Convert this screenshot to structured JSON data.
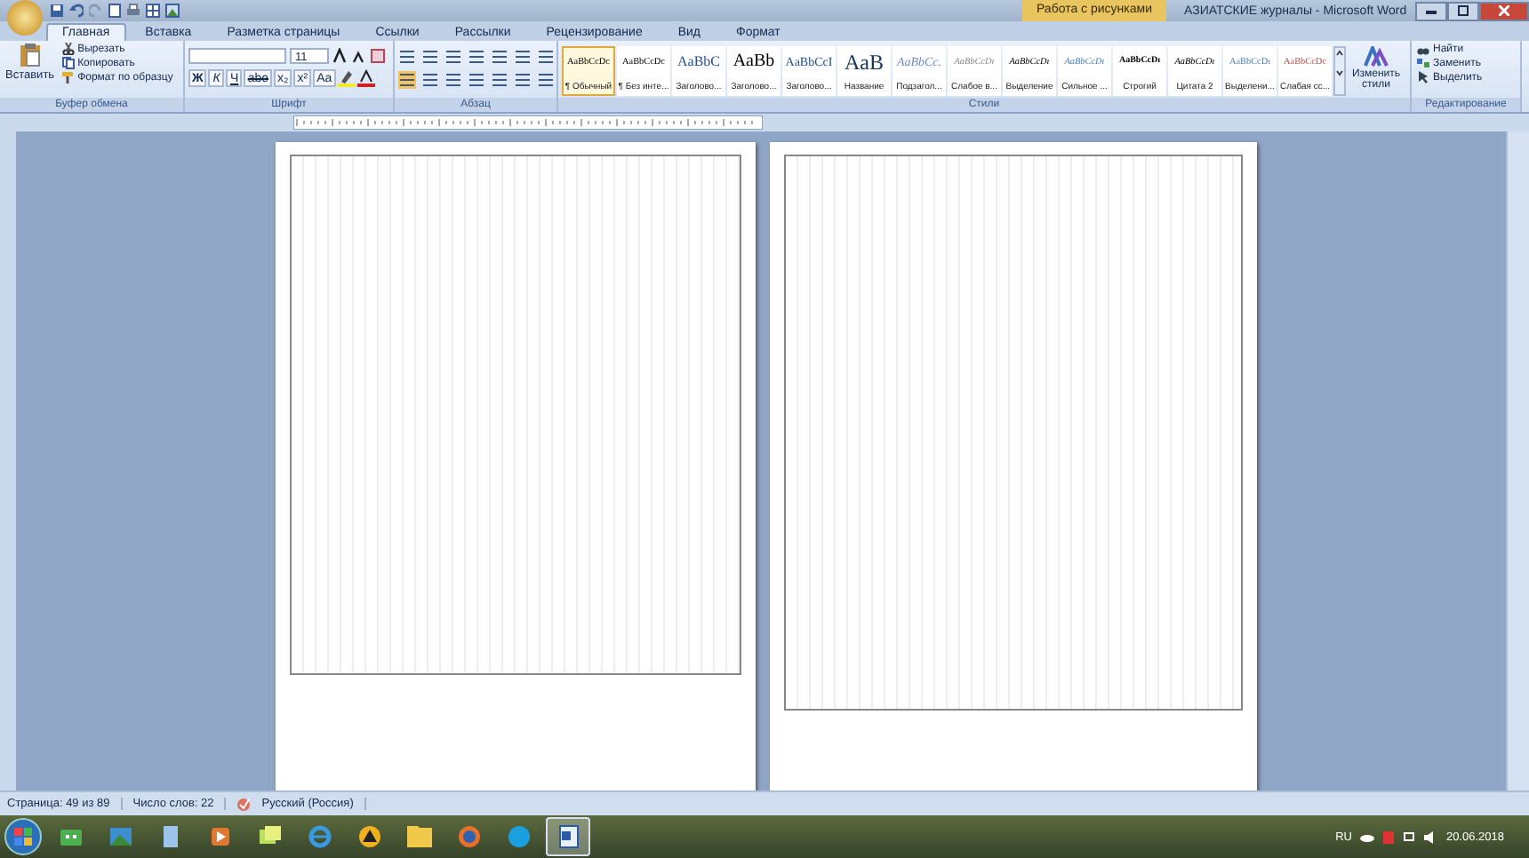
{
  "window": {
    "context_title": "Работа с рисунками",
    "title": "АЗИАТСКИЕ журналы - Microsoft Word"
  },
  "tabs": [
    {
      "label": "Главная",
      "selected": true
    },
    {
      "label": "Вставка",
      "selected": false
    },
    {
      "label": "Разметка страницы",
      "selected": false
    },
    {
      "label": "Ссылки",
      "selected": false
    },
    {
      "label": "Рассылки",
      "selected": false
    },
    {
      "label": "Рецензирование",
      "selected": false
    },
    {
      "label": "Вид",
      "selected": false
    },
    {
      "label": "Формат",
      "selected": false
    }
  ],
  "clipboard": {
    "paste": "Вставить",
    "cut": "Вырезать",
    "copy": "Копировать",
    "format_painter": "Формат по образцу",
    "group": "Буфер обмена"
  },
  "font": {
    "size": "11",
    "format_buttons": [
      "Ж",
      "К",
      "Ч",
      "abe",
      "x₂",
      "x²",
      "Aa"
    ],
    "group": "Шрифт"
  },
  "paragraph": {
    "group": "Абзац"
  },
  "styles": {
    "group": "Стили",
    "change": "Изменить стили",
    "items": [
      {
        "sample": "AaBbCcDc",
        "name": "¶ Обычный",
        "selected": true
      },
      {
        "sample": "AaBbCcDc",
        "name": "¶ Без инте...",
        "selected": false
      },
      {
        "sample": "AaBbC",
        "name": "Заголово...",
        "selected": false
      },
      {
        "sample": "AaBb",
        "name": "Заголово...",
        "selected": false
      },
      {
        "sample": "AaBbCcI",
        "name": "Заголово...",
        "selected": false
      },
      {
        "sample": "AaB",
        "name": "Название",
        "selected": false
      },
      {
        "sample": "AaBbCc.",
        "name": "Подзагол...",
        "selected": false
      },
      {
        "sample": "AaBbCcDı",
        "name": "Слабое в...",
        "selected": false
      },
      {
        "sample": "AaBbCcDı",
        "name": "Выделение",
        "selected": false
      },
      {
        "sample": "AaBbCcDı",
        "name": "Сильное ...",
        "selected": false
      },
      {
        "sample": "AaBbCcDı",
        "name": "Строгий",
        "selected": false
      },
      {
        "sample": "AaBbCcDı",
        "name": "Цитата 2",
        "selected": false
      },
      {
        "sample": "AaBbCcDı",
        "name": "Выделени...",
        "selected": false
      },
      {
        "sample": "AaBbCcDc",
        "name": "Слабая сс...",
        "selected": false
      }
    ]
  },
  "editing": {
    "find": "Найти",
    "replace": "Заменить",
    "select": "Выделить",
    "group": "Редактирование"
  },
  "status_bar": {
    "page": "Страница: 49 из 89",
    "words": "Число слов: 22",
    "language": "Русский (Россия)"
  },
  "taskbar": {
    "items": [
      {
        "kind": "media",
        "selected": false
      },
      {
        "kind": "picture",
        "selected": false
      },
      {
        "kind": "document",
        "selected": false
      },
      {
        "kind": "play",
        "selected": false
      },
      {
        "kind": "notes",
        "selected": false
      },
      {
        "kind": "browser",
        "selected": false
      },
      {
        "kind": "triangle",
        "selected": false
      },
      {
        "kind": "folder",
        "selected": false
      },
      {
        "kind": "globe",
        "selected": false
      },
      {
        "kind": "circle",
        "selected": false
      },
      {
        "kind": "word",
        "selected": true
      }
    ],
    "language": "RU",
    "date": "20.06.2018"
  }
}
